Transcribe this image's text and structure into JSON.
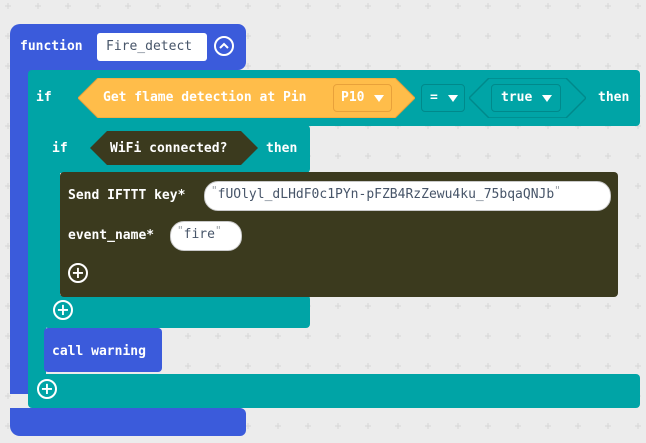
{
  "colors": {
    "function": "#3b5bdb",
    "control": "#00a4a6",
    "sensor": "#ffbd4a",
    "wifi": "#3b3a1e",
    "background": "#ececec"
  },
  "function_block": {
    "keyword": "function",
    "name": "Fire_detect",
    "collapse_icon": "chevron-up-icon"
  },
  "outer_if": {
    "if_label": "if",
    "then_label": "then",
    "sensor_label": "Get flame detection at Pin",
    "pin_value": "P10",
    "operator": "=",
    "compare_value": "true",
    "dropdown_icon": "triangle-down-icon",
    "add_icon": "plus-icon"
  },
  "inner_if": {
    "if_label": "if",
    "condition": "WiFi connected?",
    "then_label": "then",
    "add_icon": "plus-icon"
  },
  "ifttt_block": {
    "key_label": "Send IFTTT key*",
    "key_value": "fUOlyl_dLHdF0c1PYn-pFZB4RzZewu4ku_75bqaQNJb",
    "event_label": "event_name*",
    "event_value": "fire",
    "open_quote": "\"",
    "close_quote": "\"",
    "add_icon": "plus-icon"
  },
  "call_block": {
    "label": "call warning"
  }
}
